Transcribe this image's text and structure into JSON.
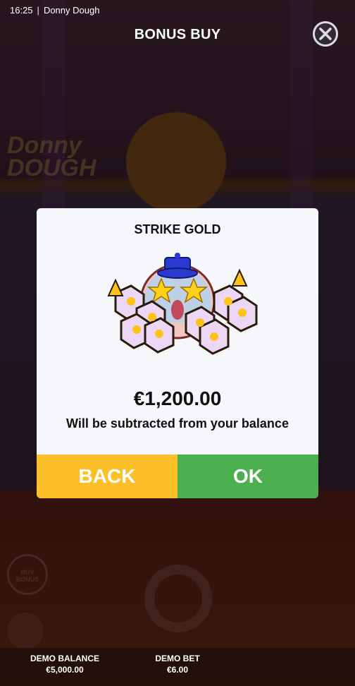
{
  "status_bar": {
    "time": "16:25",
    "game_name": "Donny Dough"
  },
  "header": {
    "title": "BONUS BUY",
    "close_icon": "close-icon"
  },
  "background": {
    "logo_text_1": "Donny",
    "logo_text_2": "DOUGH",
    "buy_bonus_label": "BUY BONUS"
  },
  "modal": {
    "title": "STRIKE GOLD",
    "artwork": "strike-gold-character-with-dice",
    "price": "€1,200.00",
    "subtitle": "Will be subtracted from your balance",
    "back_label": "BACK",
    "ok_label": "OK",
    "colors": {
      "back": "#fbbf2a",
      "ok": "#4caf50"
    }
  },
  "footer": {
    "balance_label": "DEMO BALANCE",
    "balance_value": "€5,000.00",
    "bet_label": "DEMO BET",
    "bet_value": "€6.00"
  }
}
